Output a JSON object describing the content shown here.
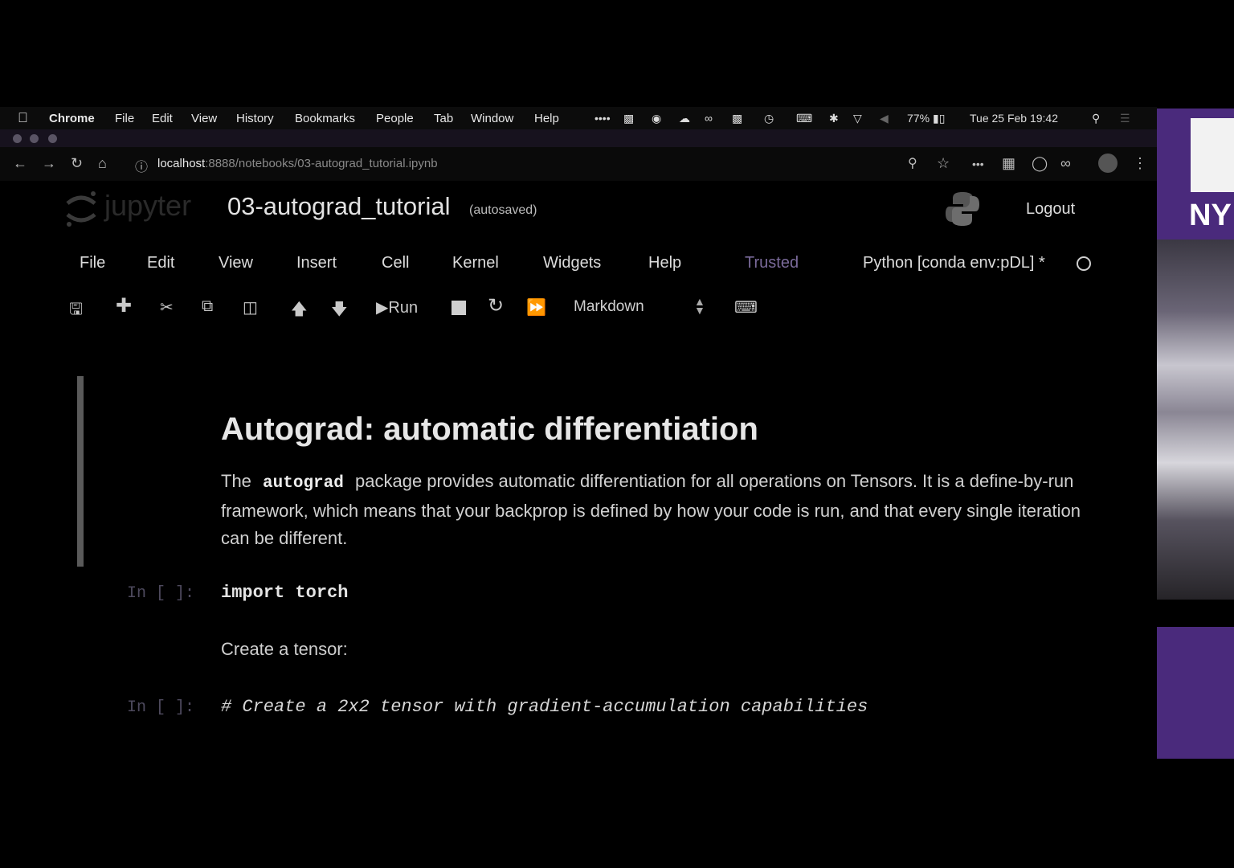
{
  "os_menu": {
    "app": "Chrome",
    "items": [
      "File",
      "Edit",
      "View",
      "History",
      "Bookmarks",
      "People",
      "Tab",
      "Window",
      "Help"
    ],
    "battery": "77%",
    "clock": "Tue 25 Feb  19:42"
  },
  "browser": {
    "url_host": "localhost",
    "url_rest": ":8888/notebooks/03-autograd_tutorial.ipynb"
  },
  "jupyter": {
    "logo_text": "jupyter",
    "notebook_title": "03-autograd_tutorial",
    "save_status": "(autosaved)",
    "logout": "Logout",
    "menu": [
      "File",
      "Edit",
      "View",
      "Insert",
      "Cell",
      "Kernel",
      "Widgets",
      "Help"
    ],
    "trusted": "Trusted",
    "kernel": "Python [conda env:pDL] *",
    "run_label": "Run",
    "cell_type": "Markdown"
  },
  "cells": {
    "heading": "Autograd: automatic differentiation",
    "para_before": "The",
    "para_code": "autograd",
    "para_after": "package provides automatic differentiation for all operations on Tensors. It is a define-by-run framework, which means that your backprop is defined by how your code is run, and that every single iteration can be different.",
    "prompt1": "In [ ]:",
    "code1": "import torch",
    "md2": "Create a tensor:",
    "prompt2": "In [ ]:",
    "code2": "# Create a 2x2 tensor with gradient-accumulation capabilities"
  },
  "side_logo": "NY",
  "colors": {
    "accent_purple": "#57068c",
    "trusted": "#7a6a9a"
  }
}
